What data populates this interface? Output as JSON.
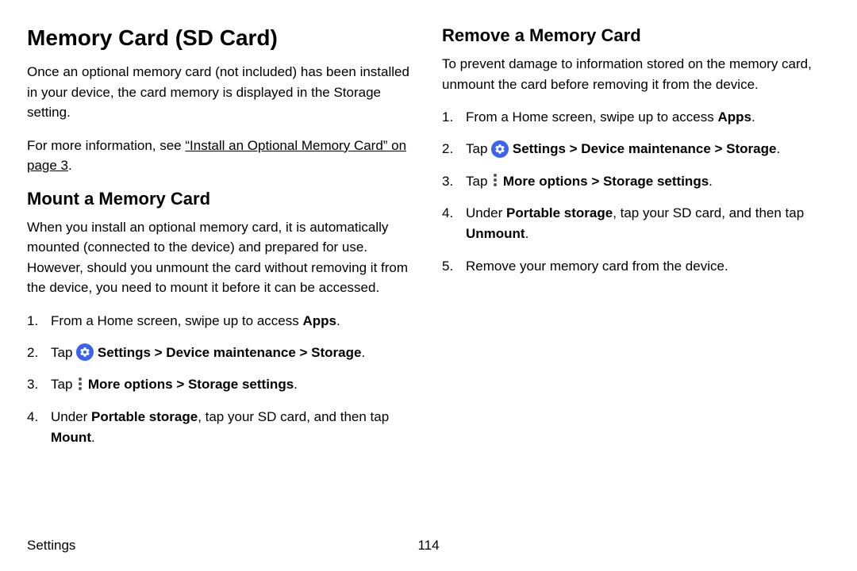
{
  "main_heading": "Memory Card (SD Card)",
  "intro_para": "Once an optional memory card (not included) has been installed in your device, the card memory is displayed in the Storage setting.",
  "moreinfo_pre": "For more information, see ",
  "moreinfo_link": "“Install an Optional Memory Card” on page 3",
  "moreinfo_post": ".",
  "mount": {
    "heading": "Mount a Memory Card",
    "para": "When you install an optional memory card, it is automatically mounted (connected to the device) and prepared for use. However, should you unmount the card without removing it from the device, you need to mount it before it can be accessed.",
    "step1_pre": "From a Home screen, swipe up to access ",
    "step1_bold": "Apps",
    "step2_pre": "Tap ",
    "step2_bold": "Settings > Device maintenance > Storage",
    "step3_pre": "Tap ",
    "step3_bold": "More options > Storage settings",
    "step4_pre": "Under ",
    "step4_bold1": "Portable storage",
    "step4_mid": ", tap your SD card, and then tap ",
    "step4_bold2": "Mount"
  },
  "remove": {
    "heading": "Remove a Memory Card",
    "para": "To prevent damage to information stored on the memory card, unmount the card before removing it from the device.",
    "step1_pre": "From a Home screen, swipe up to access ",
    "step1_bold": "Apps",
    "step2_pre": "Tap ",
    "step2_bold": "Settings > Device maintenance > Storage",
    "step3_pre": "Tap ",
    "step3_bold": "More options > Storage settings",
    "step4_pre": "Under ",
    "step4_bold1": "Portable storage",
    "step4_mid": ", tap your SD card, and then tap ",
    "step4_bold2": "Unmount",
    "step5": "Remove your memory card from the device."
  },
  "footer_section": "Settings",
  "footer_page": "114"
}
